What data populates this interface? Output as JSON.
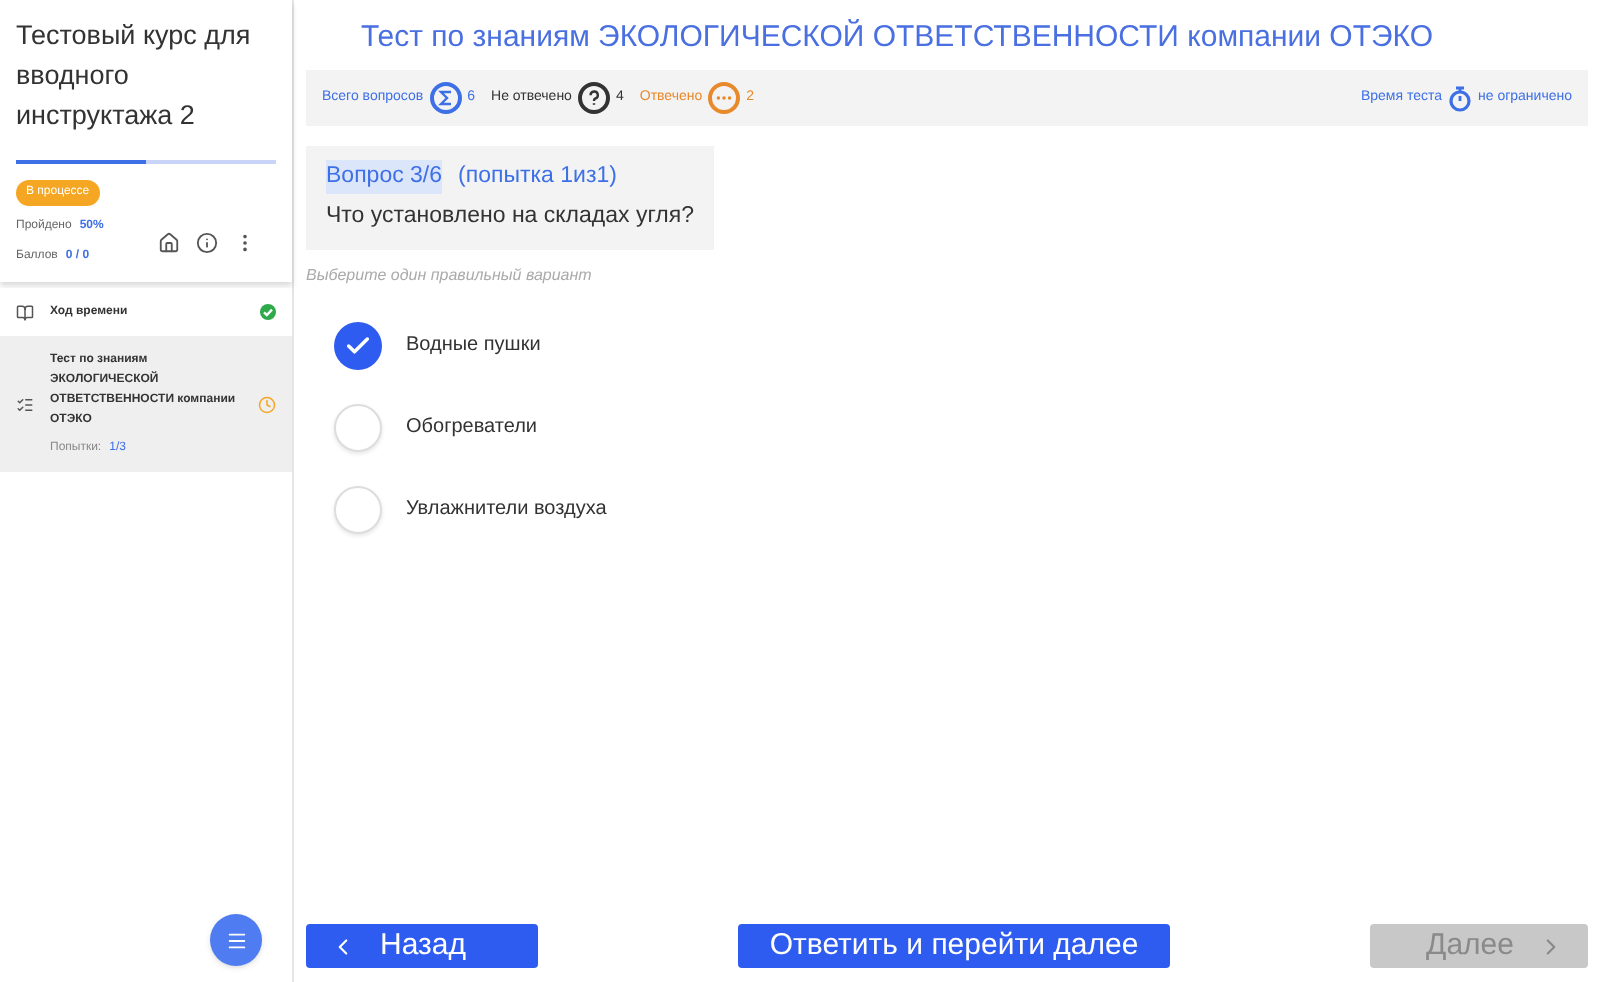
{
  "sidebar": {
    "course_title": "Тестовый курс для вводного инструктажа 2",
    "progress": {
      "level": 0.5
    },
    "status_badge": "В процессе",
    "passed": {
      "label": "Пройдено",
      "value": "50%"
    },
    "score": {
      "label": "Баллов",
      "value": "0 / 0"
    },
    "items": [
      {
        "kind": "time",
        "title": "Ход времени",
        "completed": true,
        "selected": false
      },
      {
        "kind": "test",
        "title": "Тест по знаниям ЭКОЛОГИЧЕСКОЙ ОТВЕТСТВЕННОСТИ компании ОТЭКО",
        "attempts_label": "Попытки:",
        "attempts": "1/3",
        "completed": false,
        "selected": true
      }
    ]
  },
  "header": {
    "title": "Тест по знаниям ЭКОЛОГИЧЕСКОЙ ОТВЕТСТВЕННОСТИ компании ОТЭКО"
  },
  "stats": [
    {
      "kind": "total",
      "label": "Всего вопросов",
      "value": "6",
      "color": "#3d6fe6"
    },
    {
      "kind": "unanswered",
      "label": "Не отвечено",
      "value": "4",
      "color": "#333333"
    },
    {
      "kind": "answered",
      "label": "Отвечено",
      "value": "2",
      "color": "#e8892b"
    }
  ],
  "timer": {
    "label": "Время теста",
    "value": "не ограничено"
  },
  "question": {
    "number": "Вопрос 3/6",
    "attempt": "(попытка 1из1)",
    "text": "Что установлено на складах угля?",
    "hint": "Выберите один правильный вариант",
    "options": [
      {
        "label": "Водные пушки",
        "selected": true
      },
      {
        "label": "Обогреватели",
        "selected": false
      },
      {
        "label": "Увлажнители воздуха",
        "selected": false
      }
    ]
  },
  "buttons": {
    "back": {
      "label": "Назад",
      "disabled": false
    },
    "submit": {
      "label": "Ответить и перейти далее",
      "disabled": false
    },
    "next": {
      "label": "Далее",
      "disabled": true
    }
  }
}
